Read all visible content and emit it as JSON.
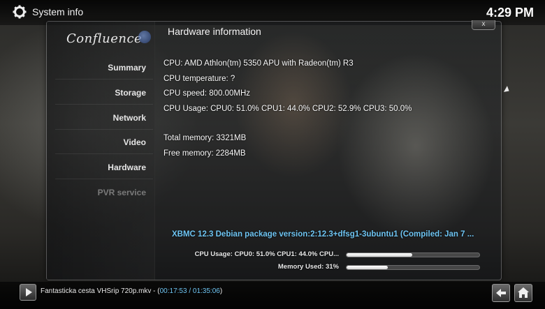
{
  "header": {
    "title": "System info",
    "clock": "4:29 PM"
  },
  "sidebar": {
    "logo": "Confluence",
    "items": [
      {
        "label": "Summary"
      },
      {
        "label": "Storage"
      },
      {
        "label": "Network"
      },
      {
        "label": "Video"
      },
      {
        "label": "Hardware"
      },
      {
        "label": "PVR service"
      }
    ]
  },
  "dialog": {
    "title": "Hardware information",
    "close_label": "x",
    "lines": [
      "CPU: AMD Athlon(tm) 5350 APU with Radeon(tm) R3",
      "CPU temperature: ?",
      "CPU speed: 800.00MHz",
      "CPU Usage: CPU0: 51.0% CPU1: 44.0% CPU2: 52.9% CPU3: 50.0%",
      "Total memory: 3321MB",
      "Free memory: 2284MB"
    ],
    "version": "XBMC 12.3 Debian package version:2:12.3+dfsg1-3ubuntu1 (Compiled: Jan  7 ...",
    "cpu_bar_label": "CPU Usage: CPU0: 51.0% CPU1: 44.0% CPU...",
    "cpu_bar_value": 0.495,
    "mem_bar_label": "Memory Used: 31%",
    "mem_bar_value": 0.31
  },
  "player": {
    "title": "Fantasticka cesta VHSrip 720p.mkv - (",
    "time": "00:17:53 / 01:35:06",
    "close_paren": ")"
  },
  "icons": {
    "settings": "gear-icon",
    "play": "play-icon",
    "back": "back-arrow-icon",
    "home": "home-icon"
  }
}
